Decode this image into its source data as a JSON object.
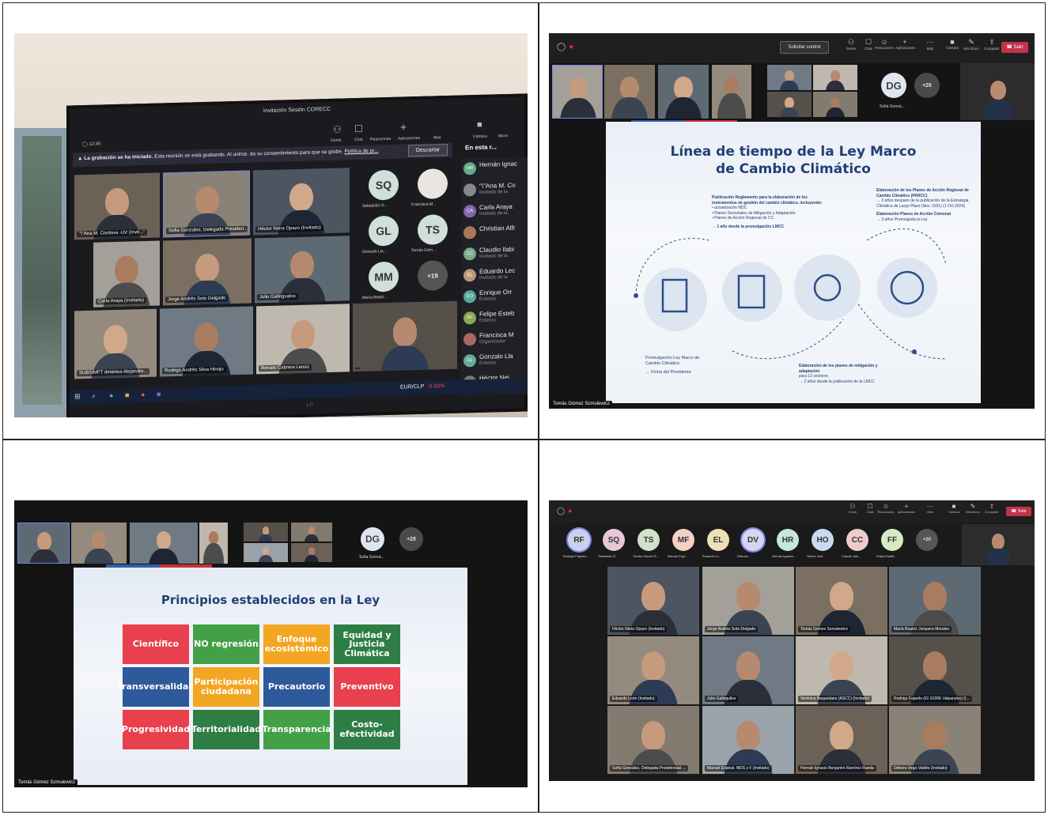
{
  "q1": {
    "window_title": "Invitación Sesión CORECC",
    "timer": "12:45",
    "toolbar": [
      "Gente",
      "Chat",
      "Reacciones",
      "Aplicaciones",
      "Más",
      "Cámara",
      "Micro"
    ],
    "recording_bold": "La grabación se ha iniciado.",
    "recording_text": "Esta reunión se está grabando. Al unirse, da su consentimiento para que se grabe.",
    "recording_link": "Política de pr...",
    "dismiss": "Descartar",
    "panel_title": "En esta r...",
    "tiles": [
      "\"\\\"Ana M. Cordova -UV (Invit...\"",
      "Sofia Gonzalez, Delegada Presiden...",
      "Héctor Neira Opazo (Invitado)",
      "Carla Araya (Invitado)",
      "Jorge Andrés Soto Delgado",
      "Julio Gallegualos",
      "SUBSIMFT delahtos Alejandro...",
      "Rodrigo Andrés Silva Hinojo",
      "Renato Cabrera Leoso",
      ""
    ],
    "avatars": [
      {
        "initials": "SQ",
        "label": "Sebastián O..."
      },
      {
        "initials": "",
        "label": "Francisca M..."
      },
      {
        "initials": "GL",
        "label": "Gonzalo Lla..."
      },
      {
        "initials": "TS",
        "label": "Tomás Góm..."
      },
      {
        "initials": "MM",
        "label": "María Beatri..."
      },
      {
        "initials": "+19",
        "label": ""
      }
    ],
    "participants": [
      {
        "i": "HR",
        "n": "Hernán Ignac",
        "s": ""
      },
      {
        "i": "",
        "n": "\"\\\"Ana M. Co",
        "s": "Invitado de la"
      },
      {
        "i": "CA",
        "n": "Carla Araya",
        "s": "Invitado de la"
      },
      {
        "i": "",
        "n": "Christian Alfr",
        "s": ""
      },
      {
        "i": "CC",
        "n": "Claudio Ilabi",
        "s": "Invitado de la"
      },
      {
        "i": "EL",
        "n": "Eduardo Lec",
        "s": "Invitado de la"
      },
      {
        "i": "EO",
        "n": "Enrique Orr",
        "s": "Externo"
      },
      {
        "i": "FF",
        "n": "Felipe Esteb",
        "s": "Externo"
      },
      {
        "i": "",
        "n": "Francisca M",
        "s": "Organizador"
      },
      {
        "i": "GL",
        "n": "Gonzalo Lla",
        "s": "Externo"
      },
      {
        "i": "",
        "n": "Héctor Nei",
        "s": ""
      }
    ],
    "taskbar_ticker": "EUR/CLP",
    "taskbar_change": "-0.93%",
    "monitor_brand": "LG"
  },
  "q2": {
    "control_button": "Solicitar control",
    "toolbar": [
      "Gente",
      "Chat",
      "Reacciones",
      "Aplicaciones",
      "Más",
      "Cámara",
      "Micrófono",
      "Compartir"
    ],
    "leave": "Salir",
    "avatar_initials": "DG",
    "avatar_label": "Sofia Gonzá...",
    "overflow": "+26",
    "slide_title_1": "Línea de tiempo de la Ley Marco",
    "slide_title_2": "de Cambio Climático",
    "block1_title": "Publicación Reglamento para la elaboración de los instrumentos de gestión del cambio climático, incluyendo:",
    "block1_items": [
      "actualización NDC",
      "Planes Sectoriales de Mitigación y Adaptación",
      "Planes de Acción Regional de CC"
    ],
    "block1_arrow": "→ 1 año desde la promulgación LMCC",
    "block2_title": "Elaboración de los Planes de Acción Regional de Cambio Climático (PARCC)",
    "block2_arrow": "→ 3 años después de la publicación de la Estrategia Climática de Largo Plazo (Nov. 2021) (1 Oct 2024)",
    "block3_title": "Elaboración Planes de Acción Comunal",
    "block3_arrow": "→ 3 años Promulgada la Ley",
    "block4_title": "Promulgación Ley Marco de Cambio Climático",
    "block4_arrow": "→ Firma del Presidente",
    "block5_title": "Elaboración de los planes de mitigación y adaptación",
    "block5_sub": "para 13 sectores",
    "block5_arrow": "→ 2 años desde la publicación de la LMCC",
    "presenter": "Tomás Gómez Szmulewicz"
  },
  "q3": {
    "avatar_initials": "DG",
    "avatar_label": "Sofia Gonzá...",
    "overflow": "+28",
    "slide_title": "Principios establecidos en la Ley",
    "principles": [
      {
        "label": "Científico",
        "color": "#e8404d"
      },
      {
        "label": "NO regresión",
        "color": "#43a047"
      },
      {
        "label": "Enfoque ecosistémico",
        "color": "#f2a621"
      },
      {
        "label": "Equidad y Justicia Climática",
        "color": "#2e7d44"
      },
      {
        "label": "Transversalidad",
        "color": "#2d5a9a"
      },
      {
        "label": "Participación ciudadana",
        "color": "#f2a621"
      },
      {
        "label": "Precautorio",
        "color": "#2d5a9a"
      },
      {
        "label": "Preventivo",
        "color": "#e8404d"
      },
      {
        "label": "Progresividad",
        "color": "#e8404d"
      },
      {
        "label": "Territorialidad",
        "color": "#2e7d44"
      },
      {
        "label": "Transparencia",
        "color": "#43a047"
      },
      {
        "label": "Costo-efectividad",
        "color": "#2e7d44"
      }
    ],
    "presenter": "Tomás Gómez Szmulewicz"
  },
  "q4": {
    "toolbar": [
      "Gente",
      "Chat",
      "Reacciones",
      "Aplicaciones",
      "Más",
      "Cámara",
      "Micrófono",
      "Compartir"
    ],
    "leave": "Salir",
    "avatars": [
      {
        "i": "RF",
        "l": "Rodrigo Fajardo...",
        "c": "#c9d2ea"
      },
      {
        "i": "SQ",
        "l": "Sebastián O...",
        "c": "#e8c7d9"
      },
      {
        "i": "TS",
        "l": "Tomás Gómez S...",
        "c": "#cfe3c8"
      },
      {
        "i": "MF",
        "l": "Manuel Espi...",
        "c": "#f1d1c2"
      },
      {
        "i": "EL",
        "l": "Eduardo Le...",
        "c": "#ece0b5"
      },
      {
        "i": "DV",
        "l": "Débora ...",
        "c": "#d7d4ef"
      },
      {
        "i": "HR",
        "l": "Hernán Ignacio...",
        "c": "#c6e6d9"
      },
      {
        "i": "HO",
        "l": "Héctor Neir...",
        "c": "#c9dbee"
      },
      {
        "i": "CC",
        "l": "Claudio Ilab...",
        "c": "#efcbcb"
      },
      {
        "i": "FF",
        "l": "Felipe Esteb...",
        "c": "#d7e9c6"
      },
      {
        "i": "+20",
        "l": "",
        "c": "#555"
      }
    ],
    "tiles": [
      "Héctor Neira Opazo (Invitado)",
      "Jorge Andrés Soto Delgado",
      "Tomás Gómez Szmulewicz",
      "María Beatriz Jorquera Morales",
      "Eduardo León (Invitado)",
      "Julio Gallegullos",
      "Verónica Baquedano (ASCC) (Invitado)",
      "Rodrigo Fajardo (IG GORE Valparaíso) (I...",
      "Sofía González, Delegada Presidencial ...",
      "Manuel Espinal. MDS y F (Invitado)",
      "Hernán Ignacio Benjamín Ramírez Rueda",
      "Débora Vega Valdés (Invitado)"
    ]
  }
}
